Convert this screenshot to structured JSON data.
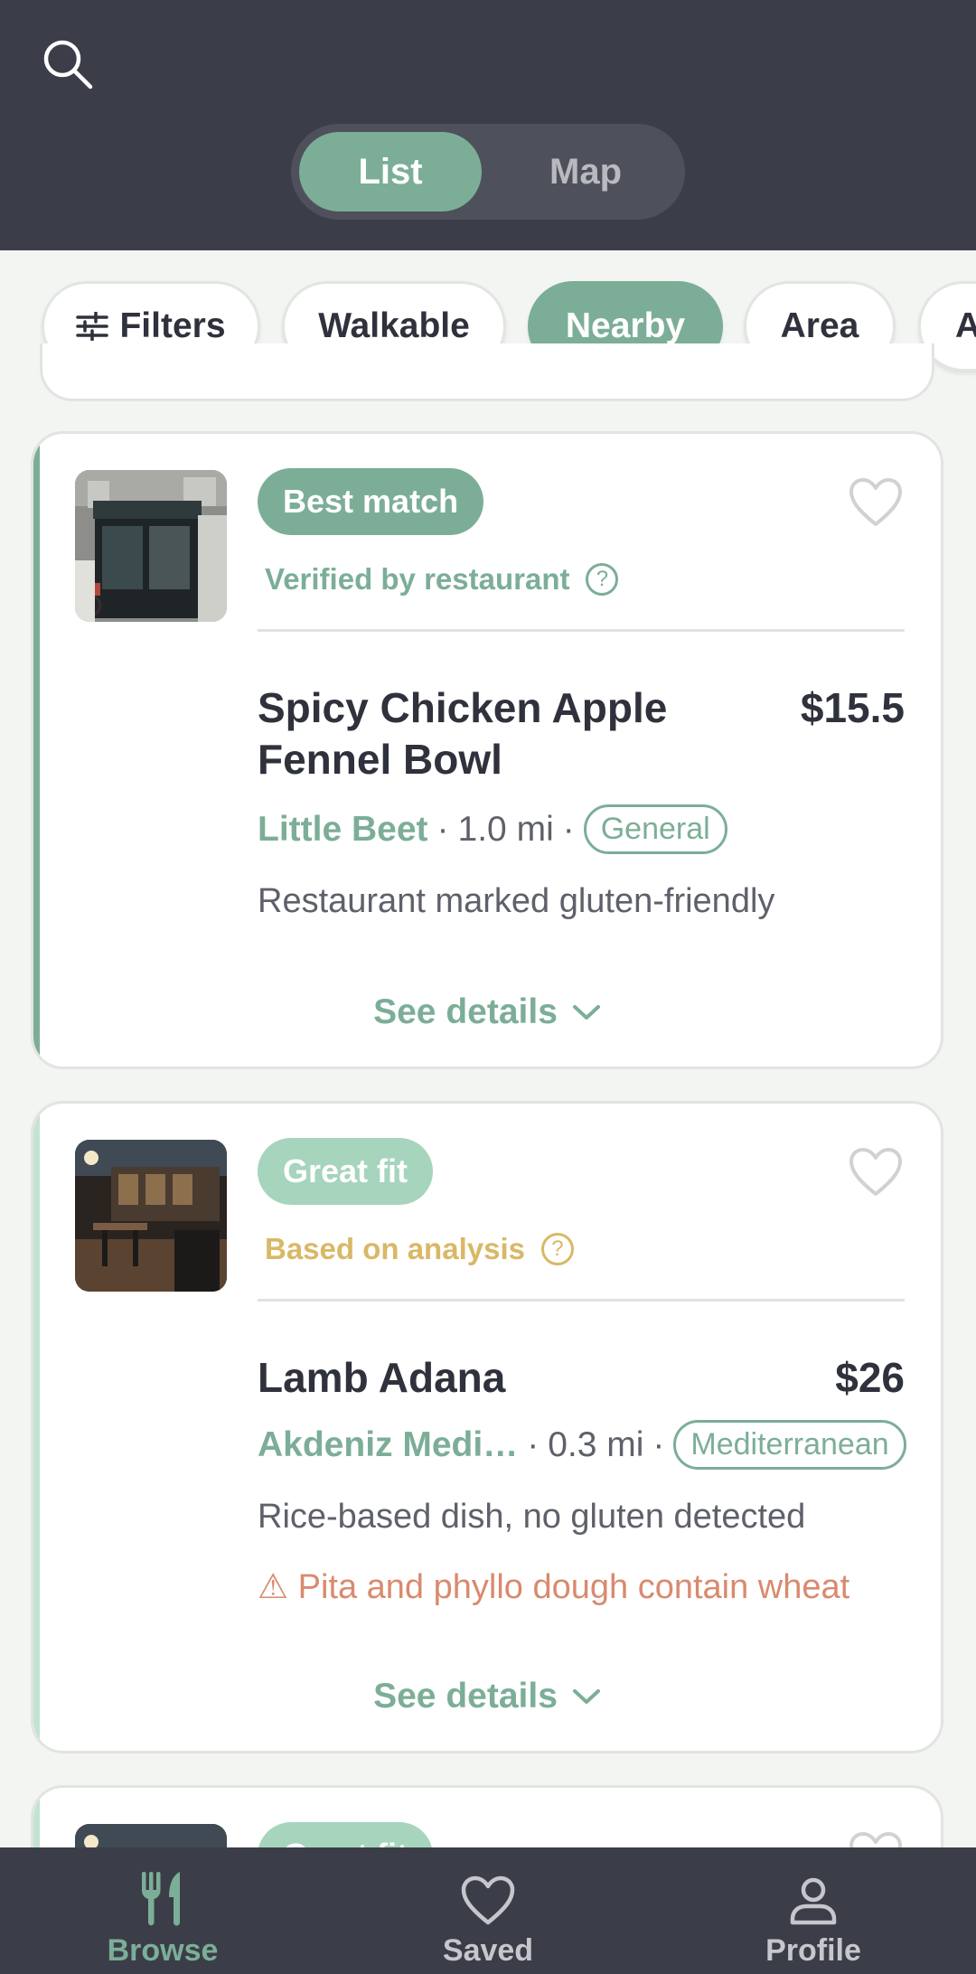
{
  "header": {
    "search_icon": "search-icon",
    "view_toggle": {
      "list_label": "List",
      "map_label": "Map",
      "selected": "List"
    }
  },
  "filters": {
    "chips": [
      {
        "label": "Filters",
        "icon": "sliders-icon",
        "active": false
      },
      {
        "label": "Walkable",
        "active": false
      },
      {
        "label": "Nearby",
        "active": true
      },
      {
        "label": "Area",
        "active": false
      },
      {
        "label": "A",
        "active": false
      }
    ]
  },
  "results": [
    {
      "badge": "Best match",
      "verification": "Verified by restaurant",
      "verification_color": "#7cae97",
      "dish": "Spicy Chicken Apple Fennel Bowl",
      "price": "$15.5",
      "restaurant": "Little Beet",
      "distance": "1.0 mi",
      "cuisine": "General",
      "description": "Restaurant marked gluten-friendly",
      "see_details": "See details"
    },
    {
      "badge": "Great fit",
      "verification": "Based on analysis",
      "verification_color": "#d9b866",
      "dish": "Lamb Adana",
      "price": "$26",
      "restaurant": "Akdeniz Medi…",
      "distance": "0.3 mi",
      "cuisine": "Mediterranean",
      "description": "Rice-based dish, no gluten detected",
      "warning": "⚠ Pita and phyllo dough contain wheat",
      "see_details": "See details"
    },
    {
      "badge": "Great fit"
    }
  ],
  "bottom_nav": {
    "items": [
      {
        "label": "Browse",
        "icon": "fork-knife-icon",
        "active": true
      },
      {
        "label": "Saved",
        "icon": "heart-icon",
        "active": false
      },
      {
        "label": "Profile",
        "icon": "person-icon",
        "active": false
      }
    ]
  },
  "colors": {
    "accent": "#7cae97",
    "header_bg": "#3b3e48",
    "warning": "#d98a6e",
    "analysis": "#d9b866"
  }
}
